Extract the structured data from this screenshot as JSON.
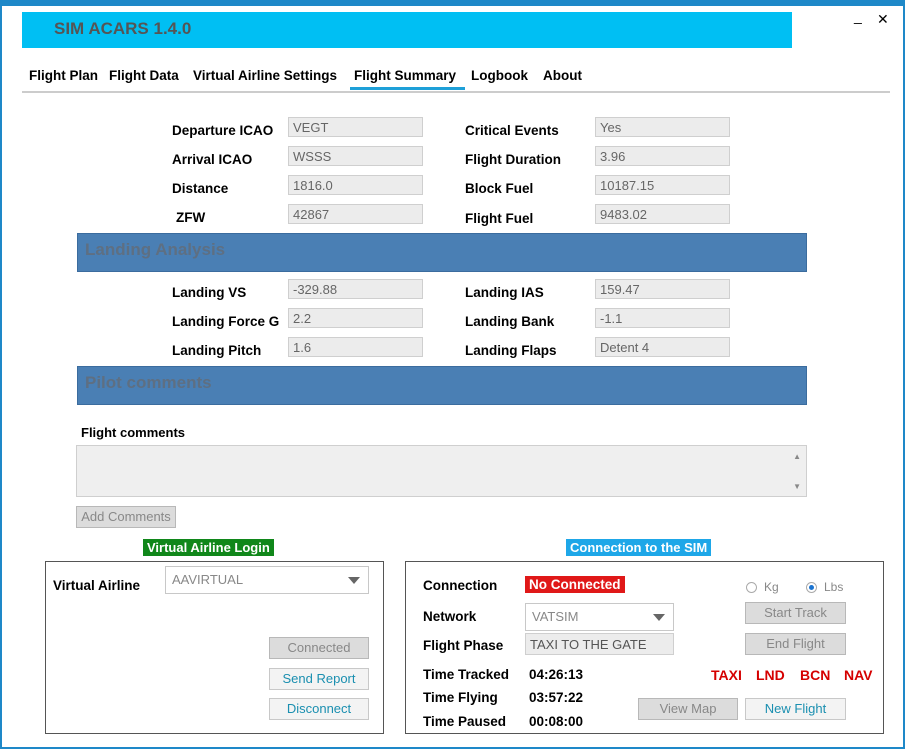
{
  "app": {
    "title": "SIM ACARS  1.4.0",
    "minimize": "_",
    "close": "✕"
  },
  "tabs": [
    {
      "label": "Flight Plan"
    },
    {
      "label": "Flight Data"
    },
    {
      "label": "Virtual Airline Settings"
    },
    {
      "label": "Flight Summary",
      "active": true
    },
    {
      "label": "Logbook"
    },
    {
      "label": "About"
    }
  ],
  "summary": {
    "departure_icao": {
      "label": "Departure ICAO",
      "value": "VEGT"
    },
    "arrival_icao": {
      "label": "Arrival ICAO",
      "value": "WSSS"
    },
    "distance": {
      "label": "Distance",
      "value": "1816.0"
    },
    "zfw": {
      "label": "ZFW",
      "value": "42867"
    },
    "critical_events": {
      "label": "Critical Events",
      "value": "Yes"
    },
    "flight_duration": {
      "label": "Flight Duration",
      "value": "3.96"
    },
    "block_fuel": {
      "label": "Block Fuel",
      "value": "10187.15"
    },
    "flight_fuel": {
      "label": "Flight Fuel",
      "value": "9483.02"
    }
  },
  "landing": {
    "section_title": "Landing Analysis",
    "vs": {
      "label": "Landing VS",
      "value": "-329.88"
    },
    "force_g": {
      "label": "Landing Force G",
      "value": "2.2"
    },
    "pitch": {
      "label": "Landing Pitch",
      "value": "1.6"
    },
    "ias": {
      "label": "Landing IAS",
      "value": "159.47"
    },
    "bank": {
      "label": "Landing Bank",
      "value": "-1.1"
    },
    "flaps": {
      "label": "Landing Flaps",
      "value": "Detent 4"
    }
  },
  "pilot": {
    "section_title": "Pilot comments",
    "comments_label": "Flight comments",
    "comments_value": "",
    "add_button": "Add Comments"
  },
  "va_login": {
    "title": "Virtual Airline Login",
    "va_label": "Virtual Airline",
    "va_value": "AAVIRTUAL",
    "connected_button": "Connected",
    "send_report_button": "Send Report",
    "disconnect_button": "Disconnect"
  },
  "sim": {
    "title": "Connection to the SIM",
    "connection_label": "Connection",
    "connection_status": "No Connected",
    "network_label": "Network",
    "network_value": "VATSIM",
    "phase_label": "Flight Phase",
    "phase_value": "TAXI TO THE GATE",
    "unit_kg": "Kg",
    "unit_lbs": "Lbs",
    "start_track": "Start Track",
    "end_flight": "End Flight",
    "time_tracked_label": "Time Tracked",
    "time_tracked": "04:26:13",
    "time_flying_label": "Time Flying",
    "time_flying": "03:57:22",
    "time_paused_label": "Time Paused",
    "time_paused": "00:08:00",
    "phases": [
      "TAXI",
      "LND",
      "BCN",
      "NAV"
    ],
    "view_map": "View Map",
    "new_flight": "New Flight"
  },
  "colors": {
    "accent": "#00bff3",
    "section": "#4a7fb4",
    "status_red": "#e01818",
    "login_green": "#10871a",
    "sim_blue": "#1ea7e8"
  }
}
